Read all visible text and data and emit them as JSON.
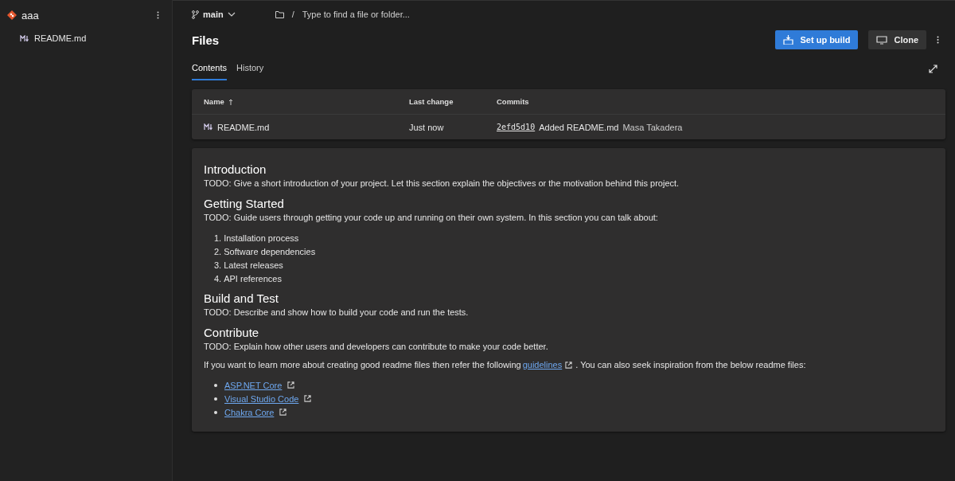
{
  "sidebar": {
    "repo": "aaa",
    "files": [
      {
        "name": "README.md",
        "selected": false
      }
    ]
  },
  "toolbar": {
    "branch": "main",
    "separator": "/",
    "path_placeholder": "Type to find a file or folder..."
  },
  "header": {
    "title": "Files",
    "buttons": [
      {
        "label": "Set up build",
        "kind": "primary"
      },
      {
        "label": "Clone",
        "kind": "secondary"
      }
    ]
  },
  "tabs": [
    {
      "label": "Contents",
      "selected": true
    },
    {
      "label": "History",
      "selected": false
    }
  ],
  "table": {
    "columns": [
      "Name",
      "Last change",
      "Commits"
    ],
    "rows": [
      {
        "name": "README.md",
        "last_change": "Just now",
        "commit_id": "2efd5d10",
        "message": "Added README.md",
        "author": "Masa Takadera"
      }
    ]
  },
  "readme": [
    {
      "kind": "heading",
      "text": "Introduction"
    },
    {
      "kind": "para",
      "text": "TODO: Give a short introduction of your project. Let this section explain the objectives or the motivation behind this project."
    },
    {
      "kind": "heading",
      "text": "Getting Started"
    },
    {
      "kind": "para",
      "text": "TODO: Guide users through getting your code up and running on their own system. In this section you can talk about:"
    },
    {
      "kind": "ol",
      "items": [
        {
          "num": "1.",
          "text": "Installation process"
        },
        {
          "num": "2.",
          "text": "Software dependencies"
        },
        {
          "num": "3.",
          "text": "Latest releases"
        },
        {
          "num": "4.",
          "text": "API references"
        }
      ]
    },
    {
      "kind": "heading",
      "text": "Build and Test"
    },
    {
      "kind": "para",
      "text": "TODO: Describe and show how to build your code and run the tests."
    },
    {
      "kind": "heading",
      "text": "Contribute"
    },
    {
      "kind": "para",
      "text": "TODO: Explain how other users and developers can contribute to make your code better."
    },
    {
      "kind": "linkpara",
      "before": "If you want to learn more about creating good readme files then refer the following ",
      "link": "guidelines",
      "after": ". You can also seek inspiration from the below readme files:"
    },
    {
      "kind": "ul",
      "items": [
        {
          "text": "ASP.NET Core"
        },
        {
          "text": "Visual Studio Code"
        },
        {
          "text": "Chakra Core"
        }
      ]
    }
  ]
}
